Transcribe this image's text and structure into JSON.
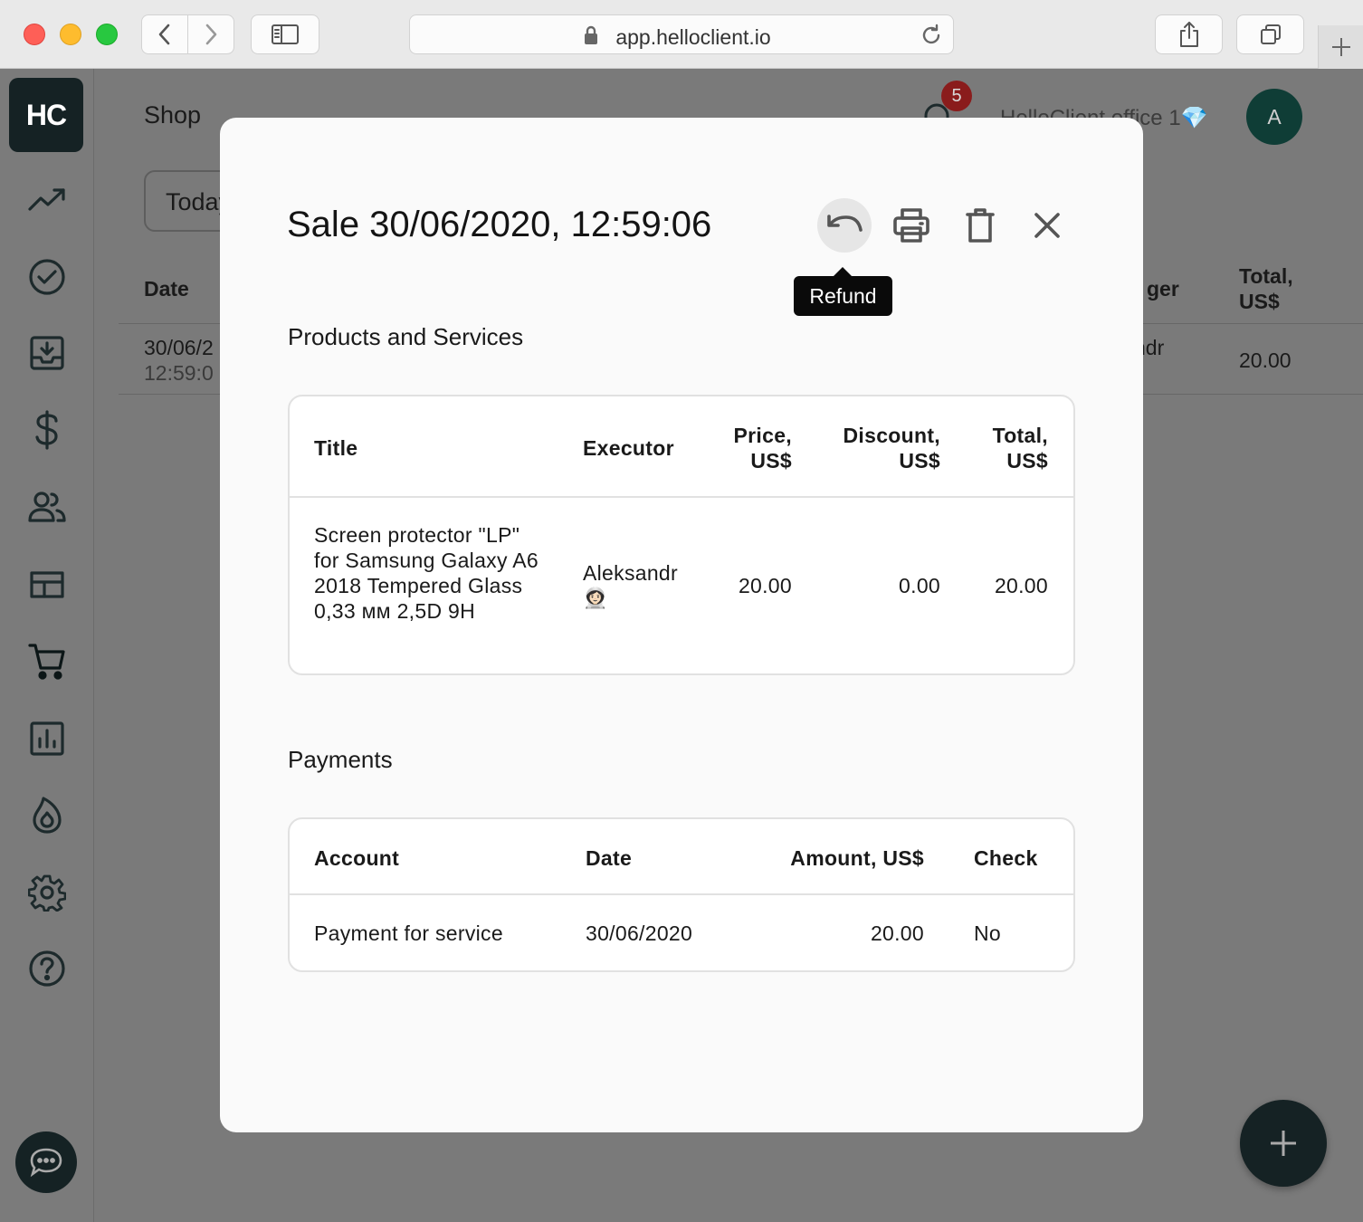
{
  "browser": {
    "url": "app.helloclient.io"
  },
  "app": {
    "logo": "HC",
    "nav_icons": [
      "trending-up-icon",
      "check-circle-icon",
      "inbox-download-icon",
      "dollar-icon",
      "people-icon",
      "table-layout-icon",
      "cart-icon",
      "bar-chart-icon",
      "flame-icon",
      "settings-icon",
      "help-icon"
    ]
  },
  "page": {
    "title": "Shop",
    "notifications_count": "5",
    "office": "HelloClient office 1💎",
    "avatar_initial": "A",
    "date_filter": "Today",
    "table": {
      "col_date": "Date",
      "col_manager_partial": "ger",
      "col_total": "Total, US$",
      "row_date": "30/06/2",
      "row_time": "12:59:0",
      "row_manager_partial": "ndr",
      "row_total": "20.00"
    }
  },
  "modal": {
    "title": "Sale 30/06/2020, 12:59:06",
    "tooltip": "Refund",
    "products": {
      "section_title": "Products and Services",
      "headers": {
        "title": "Title",
        "executor": "Executor",
        "price": "Price, US$",
        "discount": "Discount, US$",
        "total": "Total, US$"
      },
      "rows": [
        {
          "title": "Screen protector \"LP\" for Samsung Galaxy A6 2018 Tempered Glass 0,33 мм 2,5D 9H",
          "executor": "Aleksandr",
          "executor_emoji": "👩🏻‍🚀",
          "price": "20.00",
          "discount": "0.00",
          "total": "20.00"
        }
      ]
    },
    "payments": {
      "section_title": "Payments",
      "headers": {
        "account": "Account",
        "date": "Date",
        "amount": "Amount, US$",
        "check": "Check"
      },
      "rows": [
        {
          "account": "Payment for service",
          "date": "30/06/2020",
          "amount": "20.00",
          "check": "No"
        }
      ]
    }
  }
}
